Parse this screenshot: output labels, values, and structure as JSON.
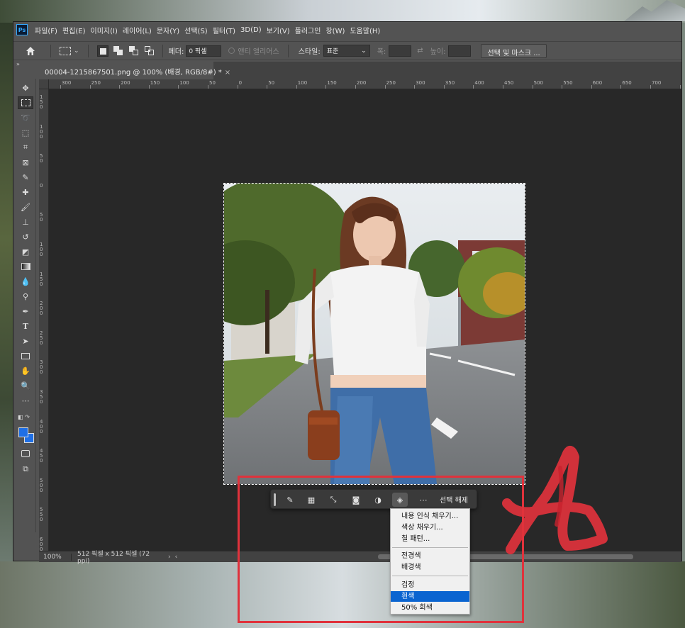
{
  "app": {
    "logo": "Ps",
    "menu": [
      "파일(F)",
      "편집(E)",
      "이미지(I)",
      "레이어(L)",
      "문자(Y)",
      "선택(S)",
      "필터(T)",
      "3D(D)",
      "보기(V)",
      "플러그인",
      "창(W)",
      "도움말(H)"
    ]
  },
  "options": {
    "feather_label": "페더:",
    "feather_value": "0 픽셀",
    "antialias_label": "앤티 앨리어스",
    "style_label": "스타일:",
    "style_value": "표준",
    "width_label": "폭:",
    "height_label": "높이:",
    "select_mask_label": "선택 및 마스크 ..."
  },
  "document": {
    "tab_title": "00004-1215867501.png @ 100% (배경, RGB/8#) *",
    "close_glyph": "×",
    "ruler_h": [
      "300",
      "250",
      "200",
      "150",
      "100",
      "50",
      "0",
      "50",
      "100",
      "150",
      "200",
      "250",
      "300",
      "350",
      "400",
      "450",
      "500",
      "550",
      "600",
      "650",
      "700",
      "750"
    ],
    "ruler_v": [
      "150",
      "100",
      "50",
      "0",
      "50",
      "100",
      "150",
      "200",
      "250",
      "300",
      "350",
      "400",
      "450",
      "500",
      "550",
      "600"
    ]
  },
  "status": {
    "zoom": "100%",
    "info": "512 픽셀 x 512 픽셀 (72 ppi)",
    "arrow_next": "›",
    "arrow_prev": "‹"
  },
  "taskbar": {
    "deselect_label": "선택 해제",
    "icons": [
      "generative-brush-icon",
      "select-subject-icon",
      "transform-icon",
      "mask-icon",
      "adjustment-icon",
      "fill-icon",
      "more-icon"
    ]
  },
  "fill_menu": {
    "items": [
      "내용 인식 채우기...",
      "색상 채우기...",
      "칠 패턴...",
      "전경색",
      "배경색",
      "검정",
      "흰색",
      "50% 회색"
    ],
    "highlighted": "흰색"
  },
  "colors": {
    "foreground": "#1f6fe5",
    "background": "#1f6fe5",
    "annotation_red": "#e0323c",
    "menu_highlight": "#0a64d0"
  }
}
